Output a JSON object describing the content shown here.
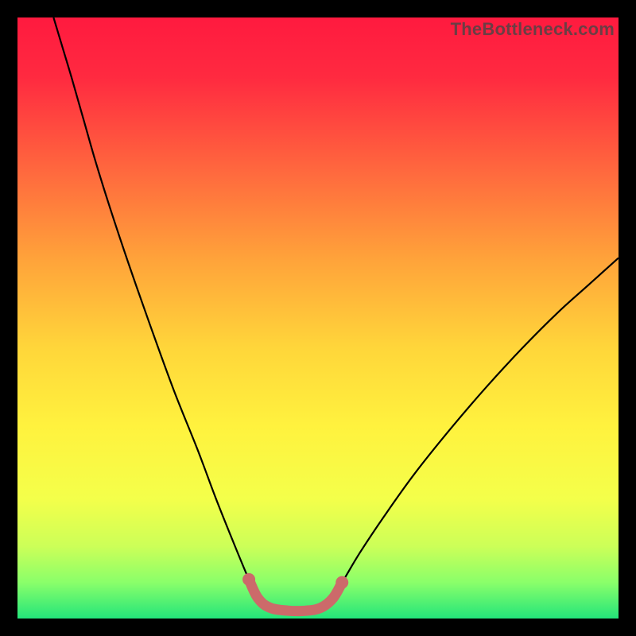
{
  "watermark": "TheBottleneck.com",
  "chart_data": {
    "type": "line",
    "title": "",
    "xlabel": "",
    "ylabel": "",
    "xlim": [
      0,
      100
    ],
    "ylim": [
      0,
      100
    ],
    "gradient_stops": [
      {
        "offset": 0.0,
        "color": "#ff1a3f"
      },
      {
        "offset": 0.1,
        "color": "#ff2a40"
      },
      {
        "offset": 0.25,
        "color": "#ff663e"
      },
      {
        "offset": 0.4,
        "color": "#ffa23a"
      },
      {
        "offset": 0.55,
        "color": "#ffd63a"
      },
      {
        "offset": 0.68,
        "color": "#fff23e"
      },
      {
        "offset": 0.8,
        "color": "#f4ff4a"
      },
      {
        "offset": 0.88,
        "color": "#ccff58"
      },
      {
        "offset": 0.94,
        "color": "#8aff6a"
      },
      {
        "offset": 1.0,
        "color": "#23e57a"
      }
    ],
    "series": [
      {
        "name": "left-curve",
        "stroke": "#000000",
        "stroke_width": 2.2,
        "points": [
          {
            "x": 6.0,
            "y": 100.0
          },
          {
            "x": 7.5,
            "y": 95.0
          },
          {
            "x": 9.0,
            "y": 90.0
          },
          {
            "x": 11.0,
            "y": 83.0
          },
          {
            "x": 13.0,
            "y": 76.0
          },
          {
            "x": 15.5,
            "y": 68.0
          },
          {
            "x": 18.5,
            "y": 59.0
          },
          {
            "x": 22.0,
            "y": 49.0
          },
          {
            "x": 26.0,
            "y": 38.0
          },
          {
            "x": 30.0,
            "y": 28.0
          },
          {
            "x": 33.0,
            "y": 20.0
          },
          {
            "x": 36.0,
            "y": 12.5
          },
          {
            "x": 38.5,
            "y": 6.5
          },
          {
            "x": 40.2,
            "y": 3.0
          }
        ]
      },
      {
        "name": "right-curve",
        "stroke": "#000000",
        "stroke_width": 2.2,
        "points": [
          {
            "x": 52.0,
            "y": 3.0
          },
          {
            "x": 54.0,
            "y": 6.0
          },
          {
            "x": 57.0,
            "y": 11.0
          },
          {
            "x": 61.0,
            "y": 17.0
          },
          {
            "x": 66.0,
            "y": 24.0
          },
          {
            "x": 72.0,
            "y": 31.5
          },
          {
            "x": 78.0,
            "y": 38.5
          },
          {
            "x": 84.0,
            "y": 45.0
          },
          {
            "x": 90.0,
            "y": 51.0
          },
          {
            "x": 95.0,
            "y": 55.5
          },
          {
            "x": 100.0,
            "y": 60.0
          }
        ]
      },
      {
        "name": "bottom-u",
        "stroke": "#cc6a6a",
        "stroke_width": 13,
        "linecap": "round",
        "points": [
          {
            "x": 38.5,
            "y": 6.5
          },
          {
            "x": 40.0,
            "y": 3.4
          },
          {
            "x": 42.0,
            "y": 1.8
          },
          {
            "x": 45.0,
            "y": 1.3
          },
          {
            "x": 48.0,
            "y": 1.3
          },
          {
            "x": 50.5,
            "y": 1.8
          },
          {
            "x": 52.5,
            "y": 3.4
          },
          {
            "x": 54.0,
            "y": 6.0
          }
        ]
      }
    ],
    "endpoint_dots": [
      {
        "x": 38.5,
        "y": 6.5,
        "r": 8,
        "color": "#cc6a6a"
      },
      {
        "x": 54.0,
        "y": 6.0,
        "r": 8,
        "color": "#cc6a6a"
      }
    ]
  }
}
